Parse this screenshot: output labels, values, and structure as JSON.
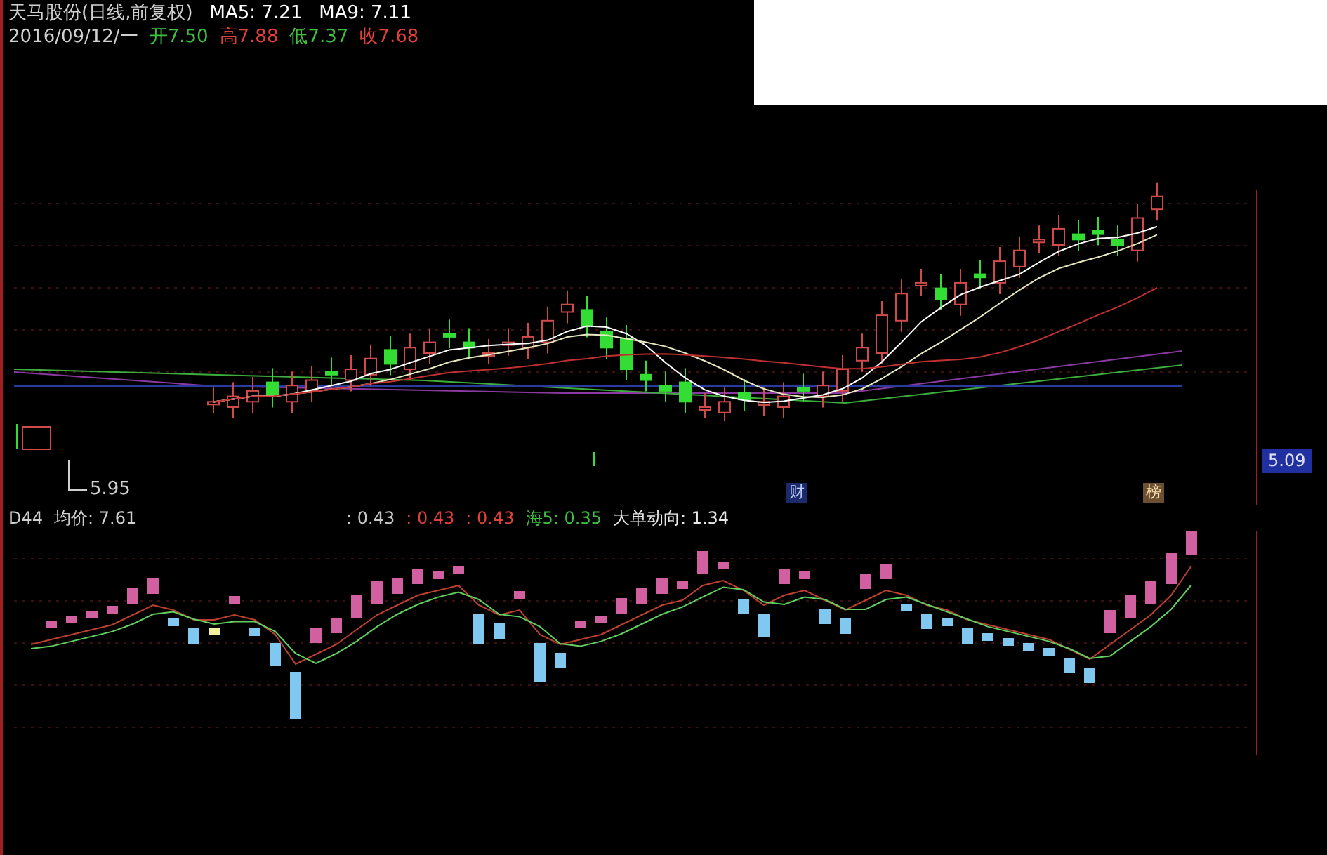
{
  "header": {
    "title": "天马股份(日线,前复权)",
    "ma": [
      {
        "label": "MA5: 7.21"
      },
      {
        "label": "MA9: 7.11"
      }
    ],
    "date": "2016/09/12/一",
    "quotes": [
      {
        "text": "开7.50",
        "color": "#3fbf3f"
      },
      {
        "text": "高7.88",
        "color": "#e0403a"
      },
      {
        "text": "低7.37",
        "color": "#3fbf3f"
      },
      {
        "text": "收7.68",
        "color": "#e0403a"
      }
    ]
  },
  "middle": {
    "low_label": "5.95",
    "price_tag": "5.09",
    "markers": [
      {
        "text": "财"
      },
      {
        "text": "榜"
      }
    ]
  },
  "indicator": {
    "name": "D44",
    "avg": "均价: 7.61",
    "values": [
      {
        "text": ": 0.43",
        "color": "#c8c8c8"
      },
      {
        "text": ": 0.43",
        "color": "#e0403a"
      },
      {
        "text": ": 0.43",
        "color": "#e0403a"
      },
      {
        "text": "海5: 0.35",
        "color": "#3fbf3f"
      },
      {
        "text": "大单动向: 1.34",
        "color": "#e8e8e8"
      }
    ]
  }
}
